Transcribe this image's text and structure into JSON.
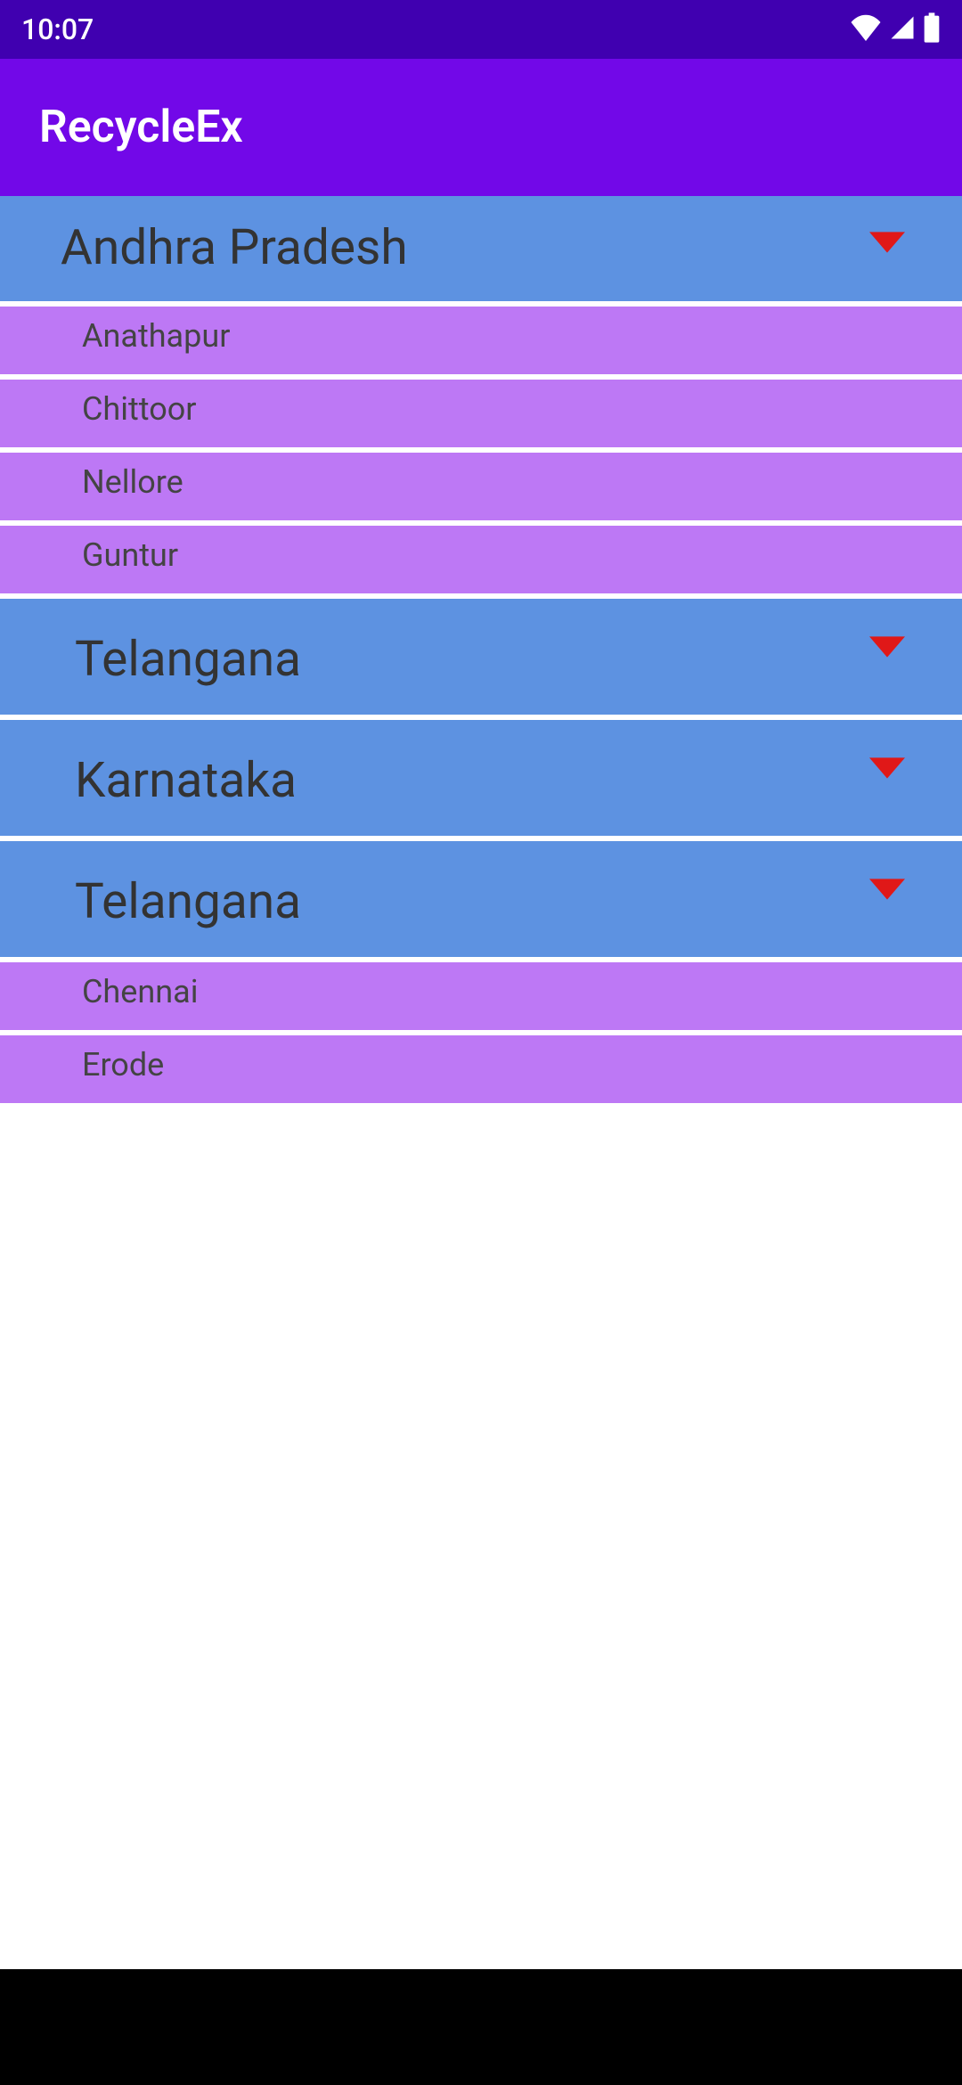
{
  "status": {
    "time": "10:07"
  },
  "app": {
    "title": "RecycleEx"
  },
  "list": {
    "groups": [
      {
        "name": "Andhra Pradesh",
        "children": [
          {
            "name": "Anathapur"
          },
          {
            "name": "Chittoor"
          },
          {
            "name": "Nellore"
          },
          {
            "name": "Guntur"
          }
        ]
      },
      {
        "name": "Telangana",
        "children": []
      },
      {
        "name": "Karnataka",
        "children": []
      },
      {
        "name": "Telangana",
        "children": [
          {
            "name": "Chennai"
          },
          {
            "name": "Erode"
          }
        ]
      }
    ]
  },
  "colors": {
    "statusBar": "#4000b0",
    "appBar": "#7208e8",
    "parentItem": "#5d92e1",
    "childItem": "#bd78f5",
    "dropdownIcon": "#e01818"
  }
}
